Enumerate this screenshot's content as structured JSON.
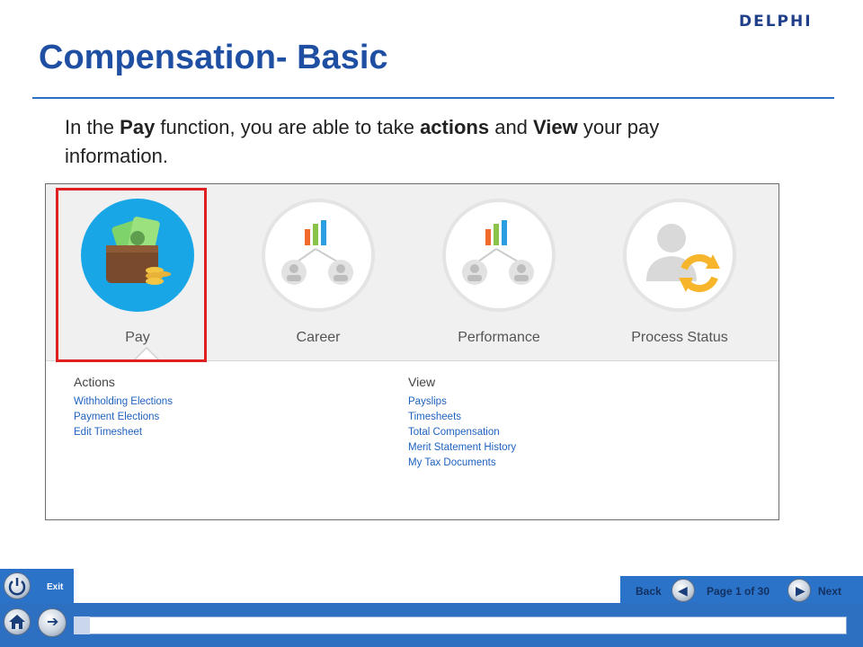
{
  "brand": {
    "logo_text": "DELPHI"
  },
  "slide": {
    "title": "Compensation- Basic",
    "intro": {
      "t1": "In the ",
      "b1": "Pay",
      "t2": " function, you are able to take ",
      "b2": "actions",
      "t3": " and ",
      "b3": "View",
      "t4": "  your pay information."
    }
  },
  "screenshot": {
    "tiles": [
      {
        "label": "Pay",
        "icon": "wallet-icon"
      },
      {
        "label": "Career",
        "icon": "career-icon"
      },
      {
        "label": "Performance",
        "icon": "performance-icon"
      },
      {
        "label": "Process Status",
        "icon": "process-status-icon"
      }
    ],
    "actions": {
      "heading": "Actions",
      "items": [
        "Withholding Elections",
        "Payment Elections",
        "Edit Timesheet"
      ]
    },
    "view": {
      "heading": "View",
      "items": [
        "Payslips",
        "Timesheets",
        "Total Compensation",
        "Merit Statement History",
        "My Tax Documents"
      ]
    }
  },
  "nav": {
    "exit_label": "Exit",
    "back_label": "Back",
    "next_label": "Next",
    "page_indicator": "Page 1 of 30"
  },
  "colors": {
    "accent": "#1f4fa3",
    "highlight": "#e02020",
    "tile_blue": "#19a6e6",
    "link": "#1f62c0"
  }
}
